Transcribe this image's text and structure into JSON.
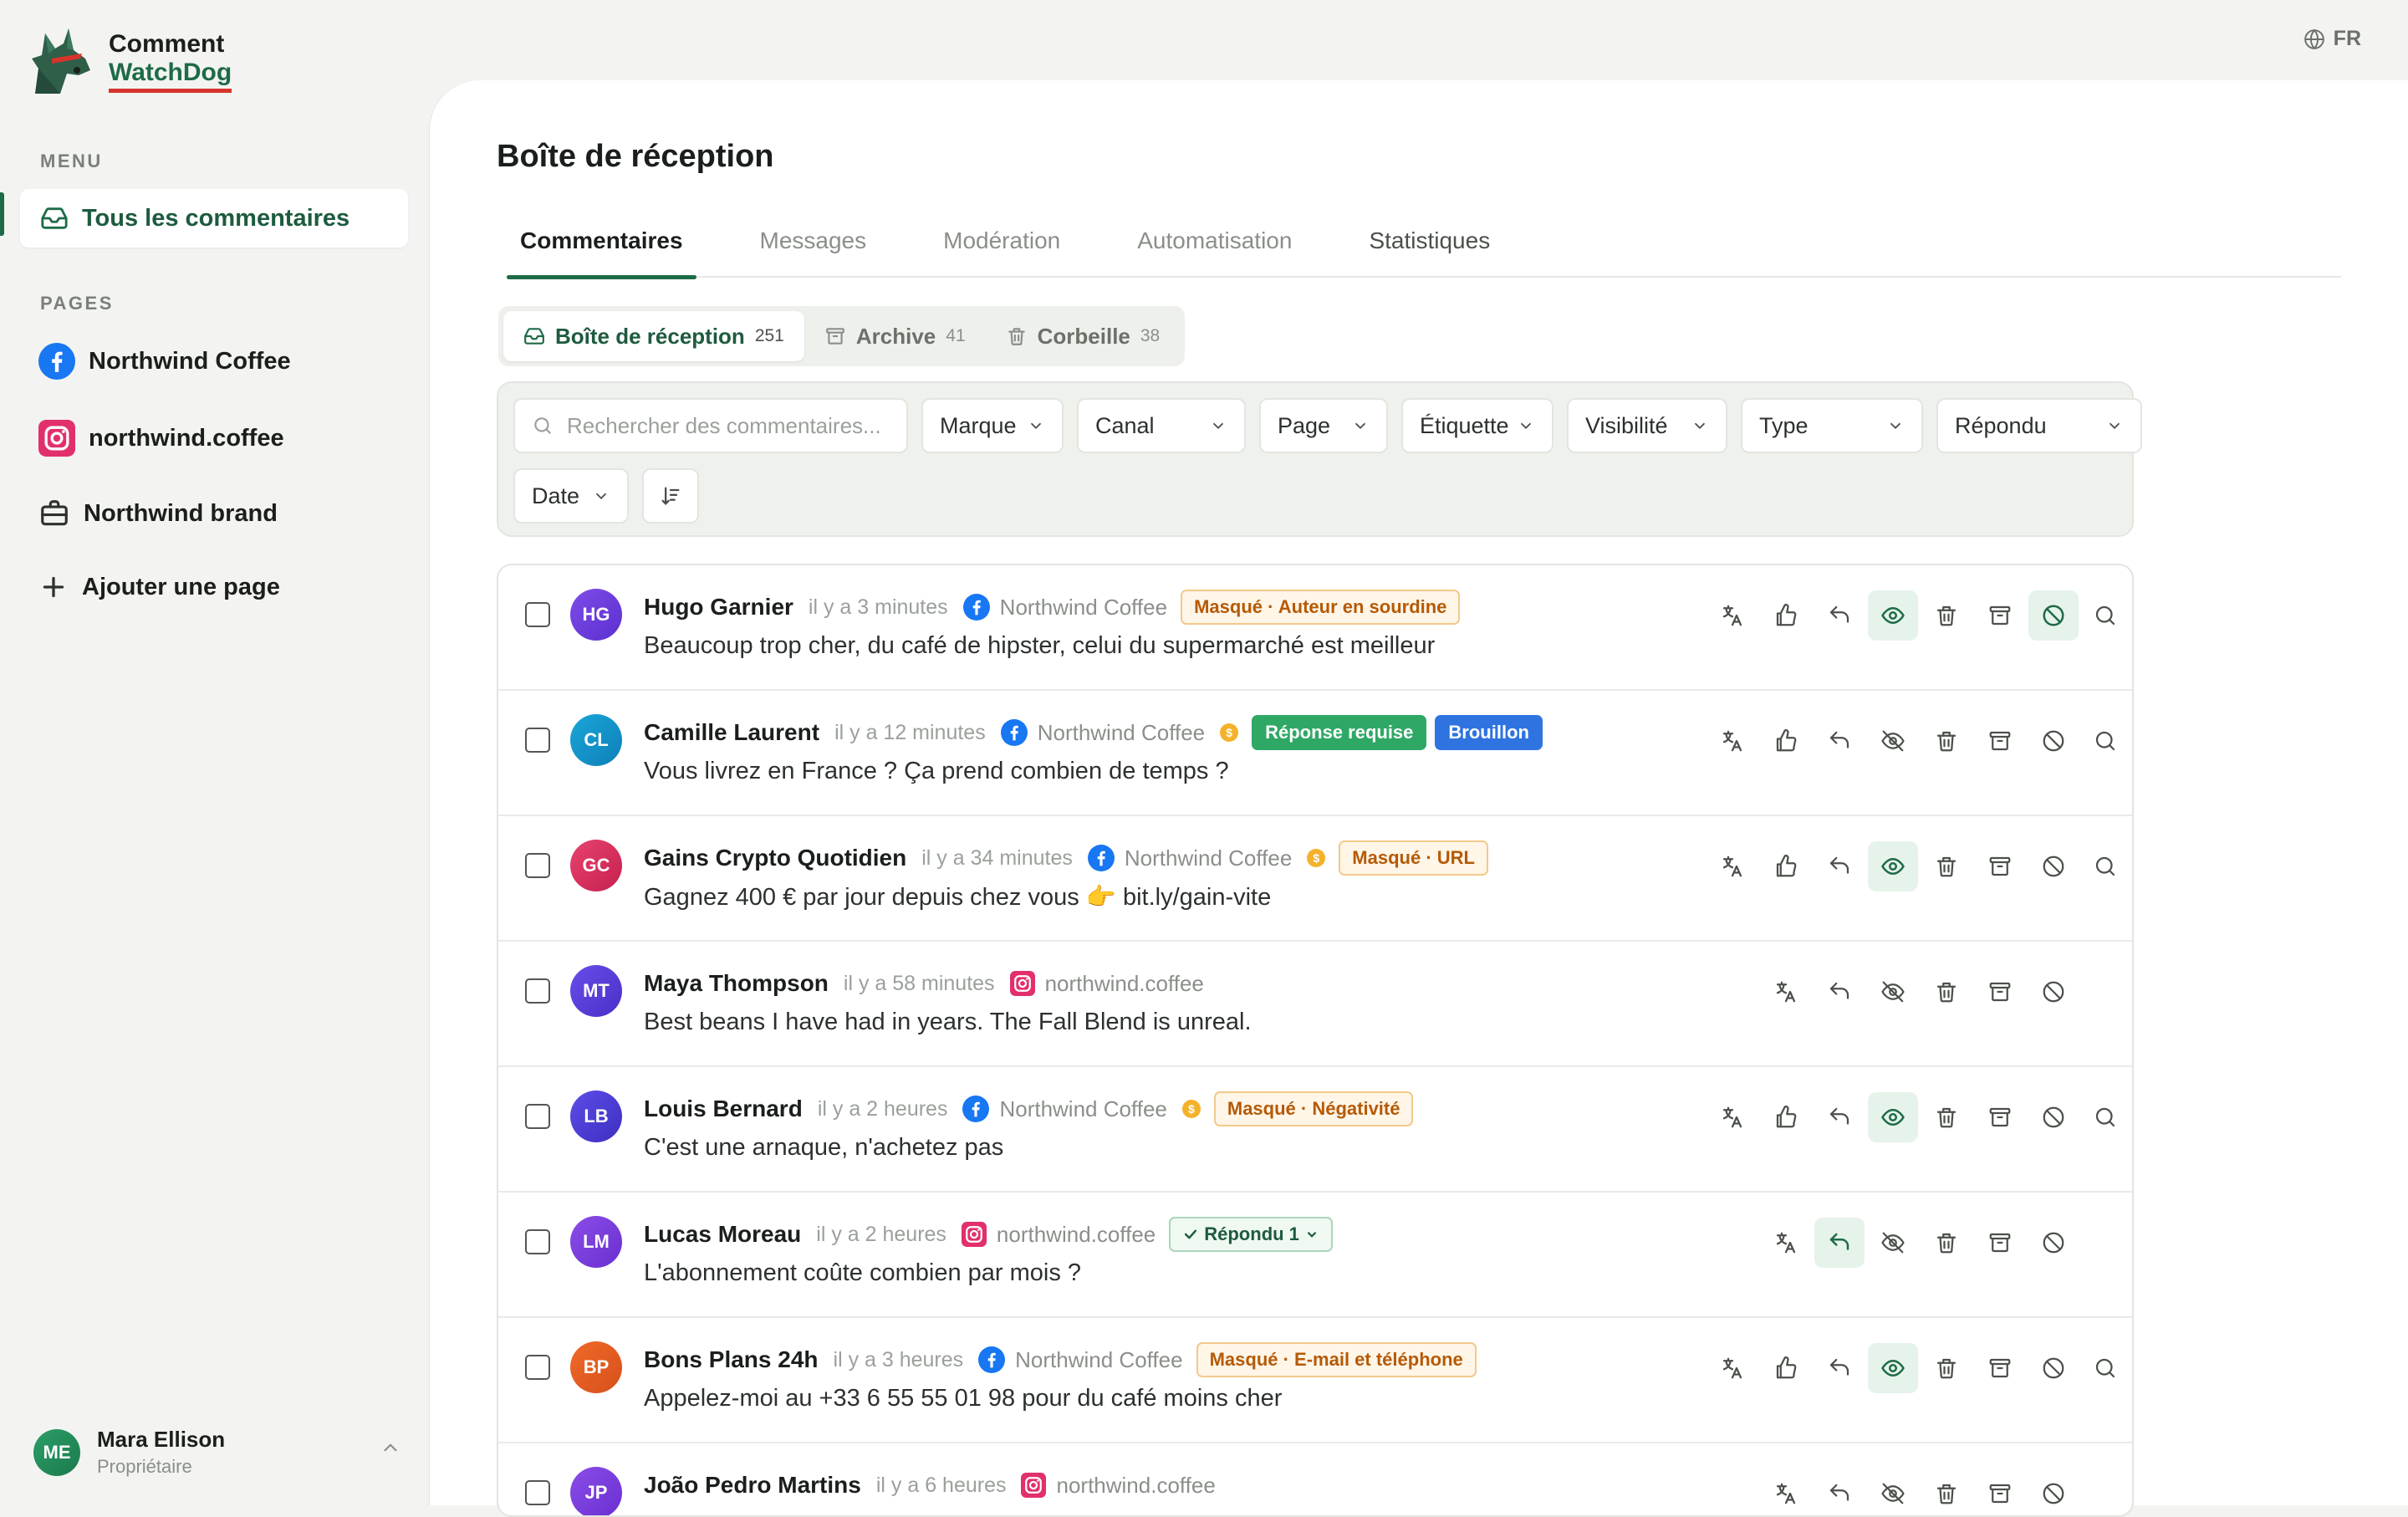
{
  "brand": {
    "line1": "Comment",
    "line2": "WatchDog"
  },
  "language": "FR",
  "sidebar": {
    "menu_label": "MENU",
    "active_item": "Tous les commentaires",
    "pages_label": "PAGES",
    "pages": [
      {
        "label": "Northwind Coffee",
        "icon": "facebook-icon"
      },
      {
        "label": "northwind.coffee",
        "icon": "instagram-icon"
      },
      {
        "label": "Northwind brand",
        "icon": "briefcase-icon"
      },
      {
        "label": "Ajouter une page",
        "icon": "plus-icon"
      }
    ],
    "user": {
      "initials": "ME",
      "name": "Mara Ellison",
      "role": "Propriétaire"
    }
  },
  "main": {
    "title": "Boîte de réception",
    "tabs": [
      "Commentaires",
      "Messages",
      "Modération",
      "Automatisation",
      "Statistiques"
    ],
    "segments": [
      {
        "label": "Boîte de réception",
        "count": "251"
      },
      {
        "label": "Archive",
        "count": "41"
      },
      {
        "label": "Corbeille",
        "count": "38"
      }
    ],
    "search_placeholder": "Rechercher des commentaires...",
    "filters": [
      "Marque",
      "Canal",
      "Page",
      "Étiquette",
      "Visibilité",
      "Type",
      "Répondu",
      "Date"
    ]
  },
  "colors": {
    "accent": "#1e6b47",
    "facebook": "#1877f2",
    "instagram": "#e1306c"
  },
  "comments": [
    {
      "initials": "HG",
      "name": "Hugo Garnier",
      "time": "il y a 3 minutes",
      "source": "Northwind Coffee",
      "channel": "facebook",
      "badges": [
        "Masqué · Auteur en sourdine"
      ],
      "text": "Beaucoup trop cher, du café de hipster, celui du supermarché est meilleur"
    },
    {
      "initials": "CL",
      "name": "Camille Laurent",
      "time": "il y a 12 minutes",
      "source": "Northwind Coffee",
      "channel": "facebook",
      "badges": [
        "Réponse requise",
        "Brouillon"
      ],
      "text": "Vous livrez en France ? Ça prend combien de temps ?"
    },
    {
      "initials": "GC",
      "name": "Gains Crypto Quotidien",
      "time": "il y a 34 minutes",
      "source": "Northwind Coffee",
      "channel": "facebook",
      "badges": [
        "Masqué · URL"
      ],
      "text": "Gagnez 400 € par jour depuis chez vous 👉 bit.ly/gain-vite"
    },
    {
      "initials": "MT",
      "name": "Maya Thompson",
      "time": "il y a 58 minutes",
      "source": "northwind.coffee",
      "channel": "instagram",
      "badges": [],
      "text": "Best beans I have had in years. The Fall Blend is unreal."
    },
    {
      "initials": "LB",
      "name": "Louis Bernard",
      "time": "il y a 2 heures",
      "source": "Northwind Coffee",
      "channel": "facebook",
      "badges": [
        "Masqué · Négativité"
      ],
      "text": "C'est une arnaque, n'achetez pas"
    },
    {
      "initials": "LM",
      "name": "Lucas Moreau",
      "time": "il y a 2 heures",
      "source": "northwind.coffee",
      "channel": "instagram",
      "badges": [
        "Répondu 1"
      ],
      "text": "L'abonnement coûte combien par mois ?"
    },
    {
      "initials": "BP",
      "name": "Bons Plans 24h",
      "time": "il y a 3 heures",
      "source": "Northwind Coffee",
      "channel": "facebook",
      "badges": [
        "Masqué · E-mail et téléphone"
      ],
      "text": "Appelez-moi au +33 6 55 55 01 98 pour du café moins cher"
    },
    {
      "initials": "JP",
      "name": "João Pedro Martins",
      "time": "il y a 6 heures",
      "source": "northwind.coffee",
      "channel": "instagram",
      "badges": [],
      "text": ""
    }
  ]
}
